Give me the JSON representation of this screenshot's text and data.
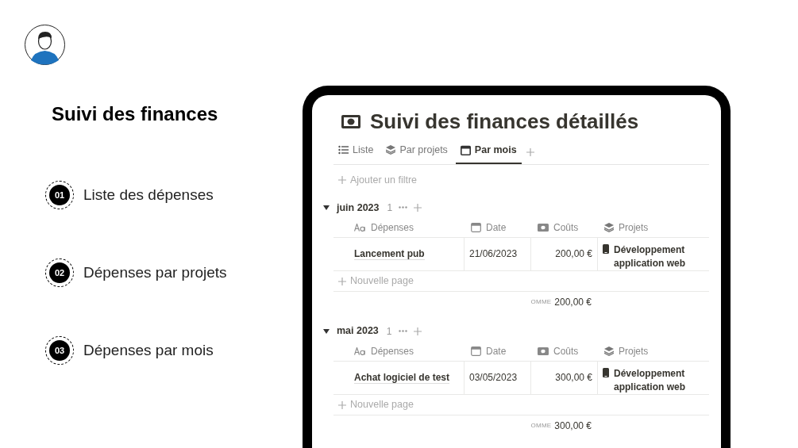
{
  "intro": {
    "title": "Suivi des finances",
    "steps": [
      {
        "number": "01",
        "label": "Liste des dépenses"
      },
      {
        "number": "02",
        "label": "Dépenses par projets"
      },
      {
        "number": "03",
        "label": "Dépenses par mois"
      }
    ]
  },
  "page": {
    "title": "Suivi des finances détaillés",
    "tabs": [
      {
        "kind": "list",
        "label": "Liste",
        "selected": false
      },
      {
        "kind": "stack",
        "label": "Par projets",
        "selected": false
      },
      {
        "kind": "calendar",
        "label": "Par mois",
        "selected": true
      }
    ],
    "filter": "Ajouter un filtre",
    "groups": [
      {
        "label": "juin 2023",
        "count": "1",
        "expanded": true,
        "columns": [
          {
            "kind": "title",
            "label": "Dépenses"
          },
          {
            "kind": "date",
            "label": "Date"
          },
          {
            "kind": "money",
            "label": "Coûts"
          },
          {
            "kind": "stack",
            "label": "Projets"
          }
        ],
        "rows": [
          {
            "name": "Lancement pub",
            "date": "21/06/2023",
            "cost": "200,00 €",
            "project": "Développement application web"
          }
        ],
        "new_page": "Nouvelle page",
        "sum_label": "OMME",
        "sum": "200,00 €"
      },
      {
        "label": "mai 2023",
        "count": "1",
        "expanded": true,
        "columns": [
          {
            "kind": "title",
            "label": "Dépenses"
          },
          {
            "kind": "date",
            "label": "Date"
          },
          {
            "kind": "money",
            "label": "Coûts"
          },
          {
            "kind": "stack",
            "label": "Projets"
          }
        ],
        "rows": [
          {
            "name": "Achat logiciel de test",
            "date": "03/05/2023",
            "cost": "300,00 €",
            "project": "Développement application web"
          }
        ],
        "new_page": "Nouvelle page",
        "sum_label": "OMME",
        "sum": "300,00 €"
      }
    ]
  }
}
